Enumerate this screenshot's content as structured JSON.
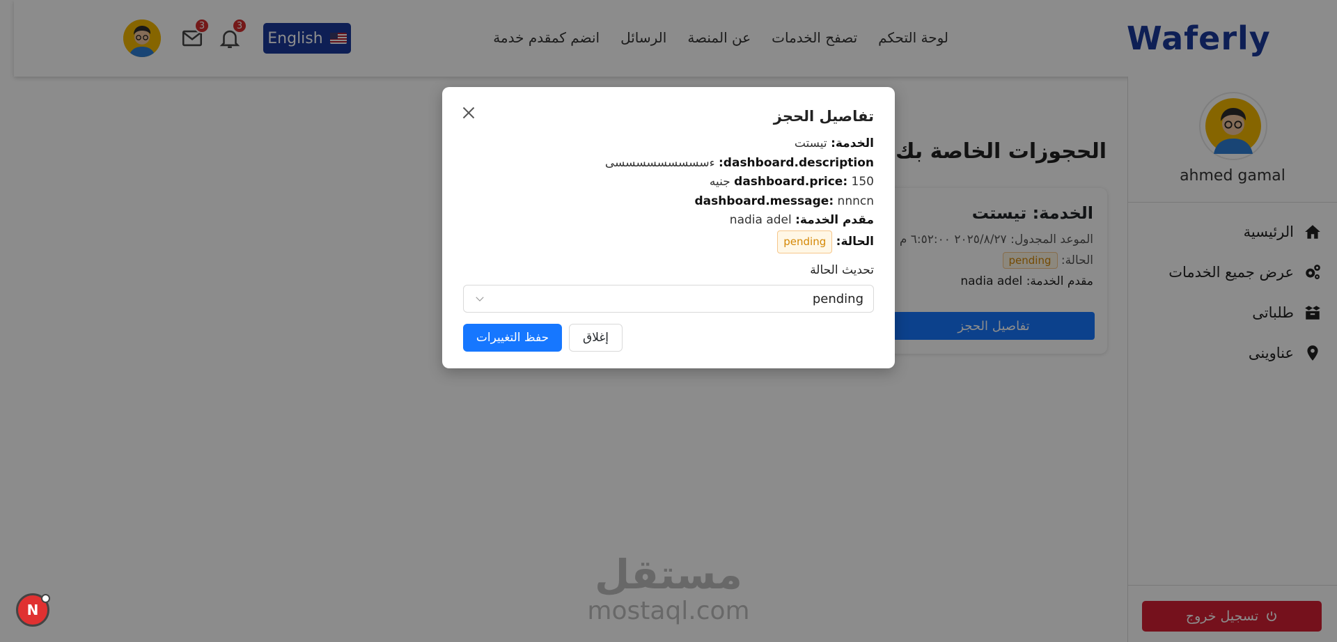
{
  "header": {
    "brand": "Waferly",
    "nav": [
      "لوحة التحكم",
      "تصفح الخدمات",
      "عن المنصة",
      "الرسائل",
      "انضم كمقدم خدمة"
    ],
    "language_label": "English",
    "notifications_count": "3",
    "messages_count": "3"
  },
  "sidebar": {
    "user_name": "ahmed gamal",
    "items": [
      {
        "label": "الرئيسية",
        "icon": "home-icon"
      },
      {
        "label": "عرض جميع الخدمات",
        "icon": "gears-icon"
      },
      {
        "label": "طلباتى",
        "icon": "box-icon"
      },
      {
        "label": "عناوينى",
        "icon": "map-pin-icon"
      }
    ],
    "logout_label": "تسجيل خروج"
  },
  "main": {
    "title": "الحجوزات الخاصة بك",
    "booking_card": {
      "service_label": "الخدمة:",
      "service_value": "تيستت",
      "scheduled_label": "الموعد المجدول:",
      "scheduled_value": "٢٠٢٥/٨/٢٧ ٦:٥٢:٠٠ م",
      "status_label": "الحالة:",
      "status_value": "pending",
      "provider_label": "مقدم الخدمة:",
      "provider_value": "nadia adel",
      "details_button": "تفاصيل الحجز"
    }
  },
  "watermark": {
    "ar": "مستقل",
    "en": "mostaql.com"
  },
  "floating_badge": "N",
  "modal": {
    "title": "تفاصيل الحجز",
    "service_label": "الخدمة:",
    "service_value": "تيستت",
    "description_label": "dashboard.description:",
    "description_value": "ءسسسسسسسسسى",
    "price_label": "dashboard.price:",
    "price_value": "150 جنيه",
    "message_label": "dashboard.message:",
    "message_value": "nnncn",
    "provider_label": "مقدم الخدمة:",
    "provider_value": "nadia adel",
    "status_label": "الحالة:",
    "status_value": "pending",
    "update_status_label": "تحديث الحالة",
    "select_value": "pending",
    "close_button": "إغلاق",
    "save_button": "حفظ التغييرات"
  },
  "colors": {
    "brand": "#1a3a9c",
    "primary": "#1677ff",
    "danger": "#d61f33",
    "pending": "#d48806"
  }
}
